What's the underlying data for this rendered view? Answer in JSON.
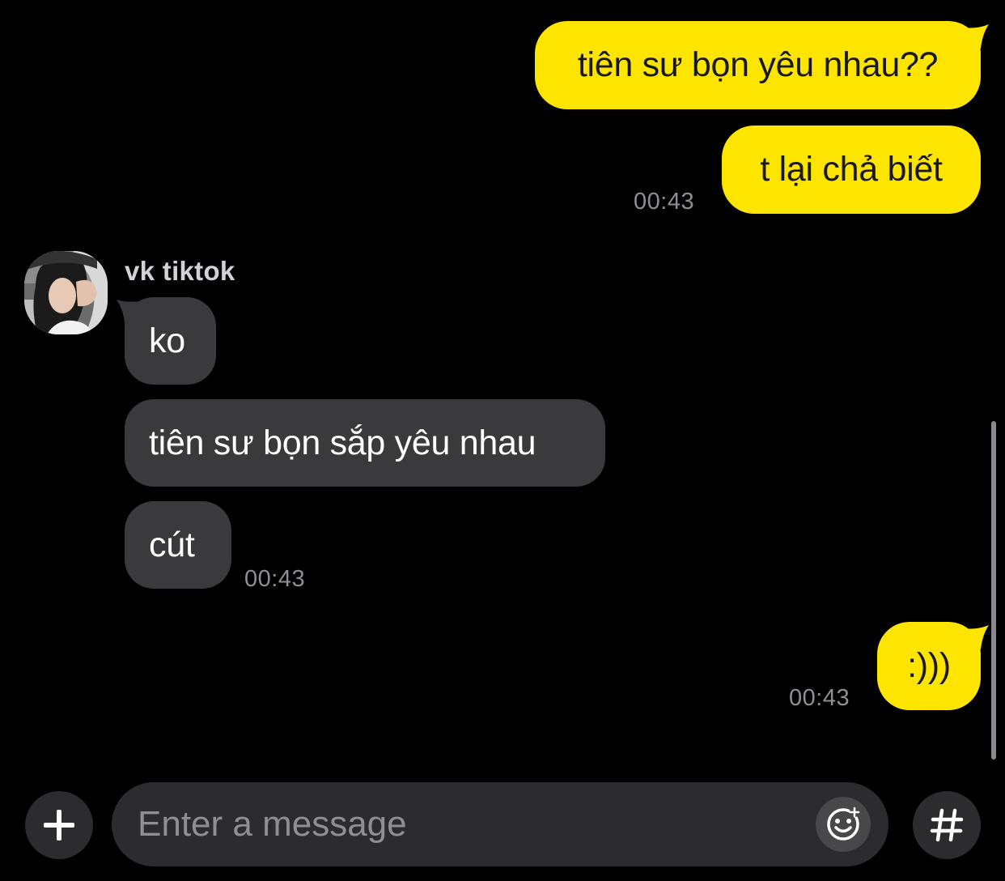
{
  "conversation": {
    "messages": [
      {
        "direction": "out",
        "text": "tiên sư bọn yêu nhau??"
      },
      {
        "direction": "out",
        "text": "t lại chả biết",
        "time": "00:43"
      },
      {
        "direction": "in",
        "sender": "vk tiktok",
        "text": "ko"
      },
      {
        "direction": "in",
        "text": "tiên sư bọn sắp yêu nhau"
      },
      {
        "direction": "in",
        "text": "cút",
        "time": "00:43"
      },
      {
        "direction": "out",
        "text": ":)))",
        "time": "00:43"
      }
    ]
  },
  "composer": {
    "placeholder": "Enter a message",
    "attach_icon": "plus-icon",
    "emoji_icon": "smiley-icon",
    "hashtag_icon": "hashtag-icon"
  },
  "colors": {
    "background": "#000000",
    "outgoing_bubble": "#FEE500",
    "incoming_bubble": "#3A3A3C",
    "timestamp": "#8E8E93"
  }
}
